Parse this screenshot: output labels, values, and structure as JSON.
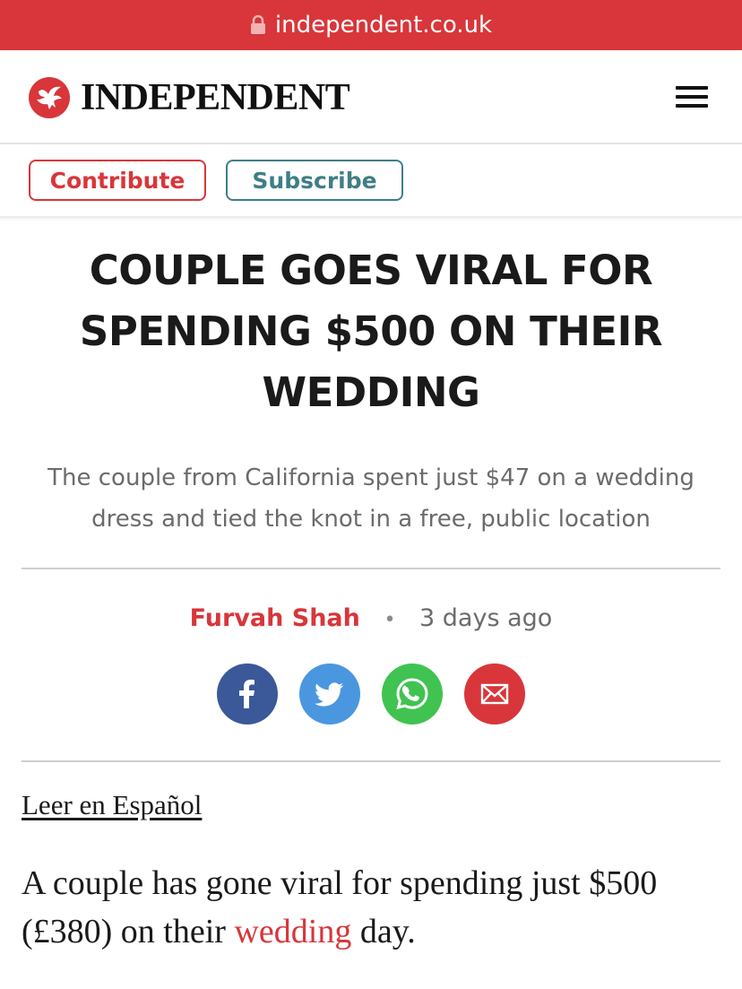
{
  "browser": {
    "url": "independent.co.uk"
  },
  "header": {
    "brand": "INDEPENDENT",
    "contribute_label": "Contribute",
    "subscribe_label": "Subscribe"
  },
  "article": {
    "headline": "COUPLE GOES VIRAL FOR SPENDING $500 ON THEIR WEDDING",
    "standfirst": "The couple from California spent just $47 on a wedding dress and tied the knot in a free, public location",
    "author": "Furvah Shah",
    "separator": "•",
    "time": "3 days ago",
    "share_icons": [
      "facebook-icon",
      "twitter-icon",
      "whatsapp-icon",
      "email-icon"
    ],
    "language_link": "Leer en Español",
    "body_before": "A couple has gone viral for spending just $500 (£380) on their ",
    "body_link": "wedding",
    "body_after": " day."
  },
  "colors": {
    "accent": "#d8363a",
    "subscribe": "#3f7e86",
    "facebook": "#3b5998",
    "twitter": "#4a97e0",
    "whatsapp": "#40c351"
  }
}
